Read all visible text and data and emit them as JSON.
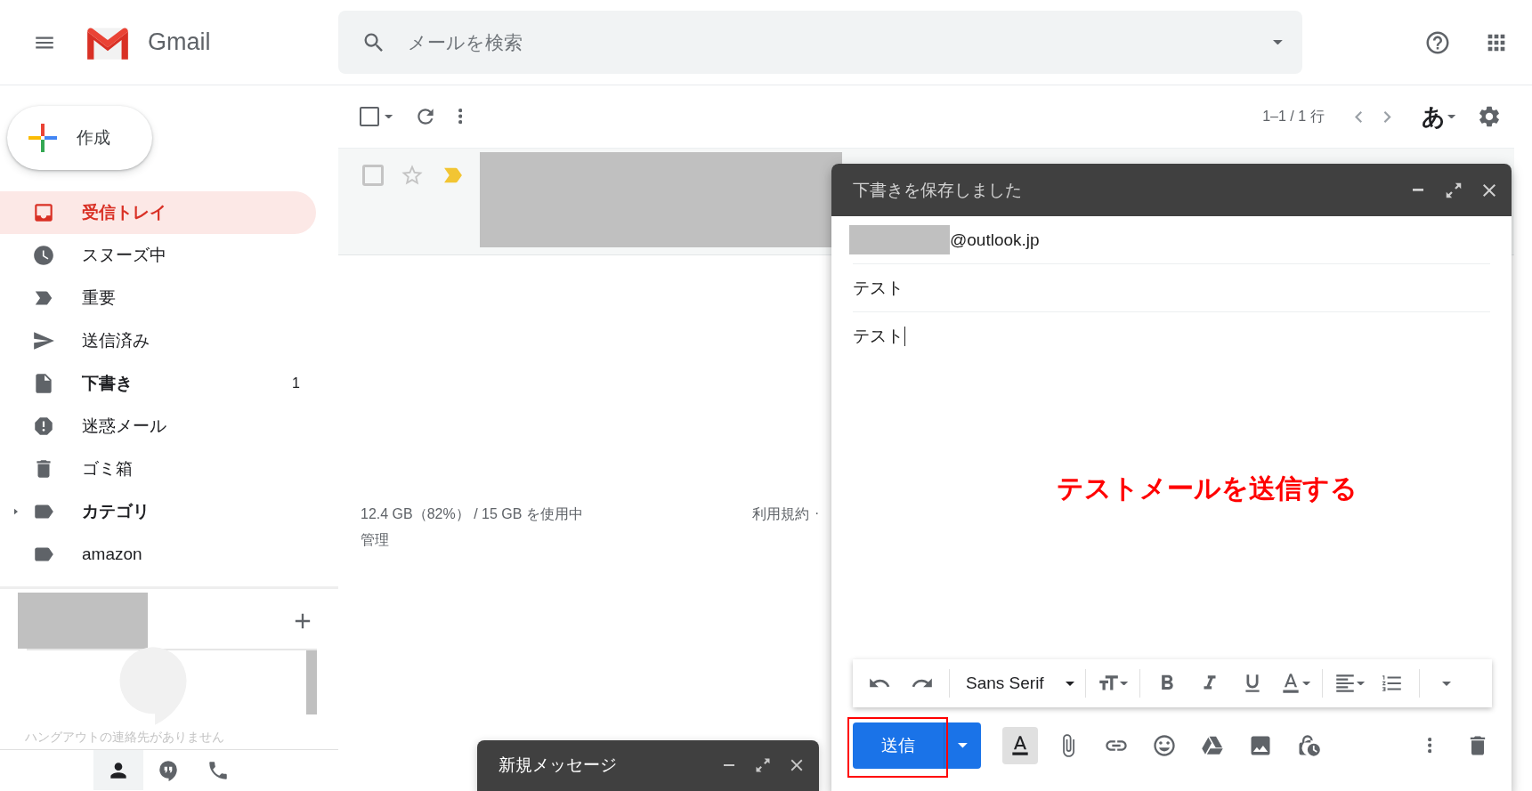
{
  "header": {
    "app_name": "Gmail",
    "search": {
      "placeholder": "メールを検索"
    }
  },
  "compose_button": {
    "label": "作成"
  },
  "sidebar": {
    "items": [
      {
        "kind": "inbox",
        "label": "受信トレイ",
        "selected": true,
        "bold": true,
        "expandable": false
      },
      {
        "kind": "snoozed",
        "label": "スヌーズ中",
        "selected": false,
        "bold": false,
        "expandable": false
      },
      {
        "kind": "important",
        "label": "重要",
        "selected": false,
        "bold": false,
        "expandable": false
      },
      {
        "kind": "sent",
        "label": "送信済み",
        "selected": false,
        "bold": false,
        "expandable": false
      },
      {
        "kind": "drafts",
        "label": "下書き",
        "count": "1",
        "selected": false,
        "bold": true,
        "expandable": false
      },
      {
        "kind": "spam",
        "label": "迷惑メール",
        "selected": false,
        "bold": false,
        "expandable": false
      },
      {
        "kind": "trash",
        "label": "ゴミ箱",
        "selected": false,
        "bold": false,
        "expandable": false
      },
      {
        "kind": "label",
        "label": "カテゴリ",
        "selected": false,
        "bold": true,
        "expandable": true
      },
      {
        "kind": "label",
        "label": "amazon",
        "selected": false,
        "bold": false,
        "expandable": false
      }
    ]
  },
  "hangouts": {
    "empty_text": "ハングアウトの連絡先がありません",
    "tabs": [
      {
        "kind": "contacts",
        "selected": true
      },
      {
        "kind": "conversations",
        "selected": false
      },
      {
        "kind": "phone",
        "selected": false
      }
    ]
  },
  "toolbar": {
    "select_all": {
      "checked": false
    },
    "page_range": "1–1 / 1 行",
    "input_mode": "あ"
  },
  "messages": [
    {
      "checked": false,
      "starred": false,
      "important": true
    }
  ],
  "footer": {
    "storage": "12.4 GB（82%） / 15 GB を使用中",
    "manage": "管理",
    "terms": "利用規約",
    "terms_separator": "·"
  },
  "compose": {
    "title": "下書きを保存しました",
    "to": "@outlook.jp",
    "subject": "テスト",
    "body": "テスト",
    "font": "Sans Serif",
    "send": "送信"
  },
  "annotation": {
    "text": "テストメールを送信する",
    "highlight_send": true
  },
  "minimized_compose": {
    "title": "新規メッセージ"
  }
}
